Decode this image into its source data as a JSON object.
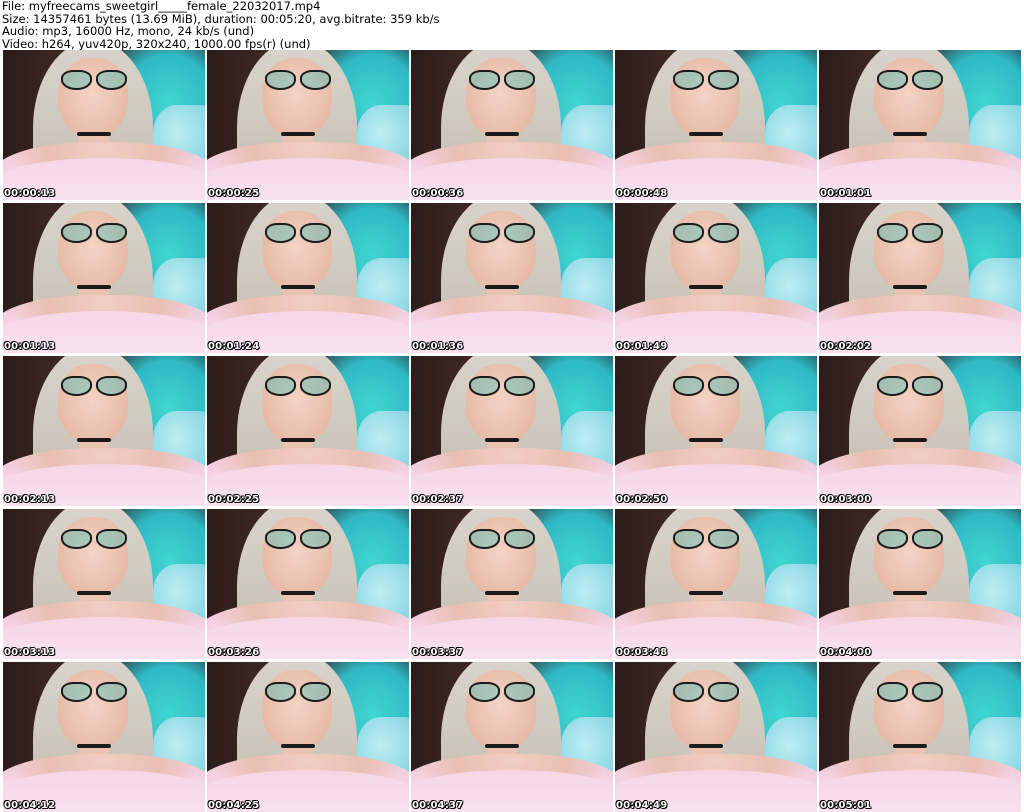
{
  "header": {
    "line1": "File: myfreecams_sweetgirl_____female_22032017.mp4",
    "line2": "Size: 14357461 bytes (13.69 MiB), duration: 00:05:20, avg.bitrate: 359 kb/s",
    "line3": "Audio: mp3, 16000 Hz, mono, 24 kb/s (und)",
    "line4": "Video: h264, yuv420p, 320x240, 1000.00 fps(r) (und)"
  },
  "thumbnails": [
    {
      "time": "00:00:13"
    },
    {
      "time": "00:00:25"
    },
    {
      "time": "00:00:36"
    },
    {
      "time": "00:00:48"
    },
    {
      "time": "00:01:01"
    },
    {
      "time": "00:01:13"
    },
    {
      "time": "00:01:24"
    },
    {
      "time": "00:01:36"
    },
    {
      "time": "00:01:49"
    },
    {
      "time": "00:02:02"
    },
    {
      "time": "00:02:13"
    },
    {
      "time": "00:02:25"
    },
    {
      "time": "00:02:37"
    },
    {
      "time": "00:02:50"
    },
    {
      "time": "00:03:00"
    },
    {
      "time": "00:03:13"
    },
    {
      "time": "00:03:26"
    },
    {
      "time": "00:03:37"
    },
    {
      "time": "00:03:48"
    },
    {
      "time": "00:04:00"
    },
    {
      "time": "00:04:12"
    },
    {
      "time": "00:04:25"
    },
    {
      "time": "00:04:37"
    },
    {
      "time": "00:04:49"
    },
    {
      "time": "00:05:01"
    }
  ]
}
